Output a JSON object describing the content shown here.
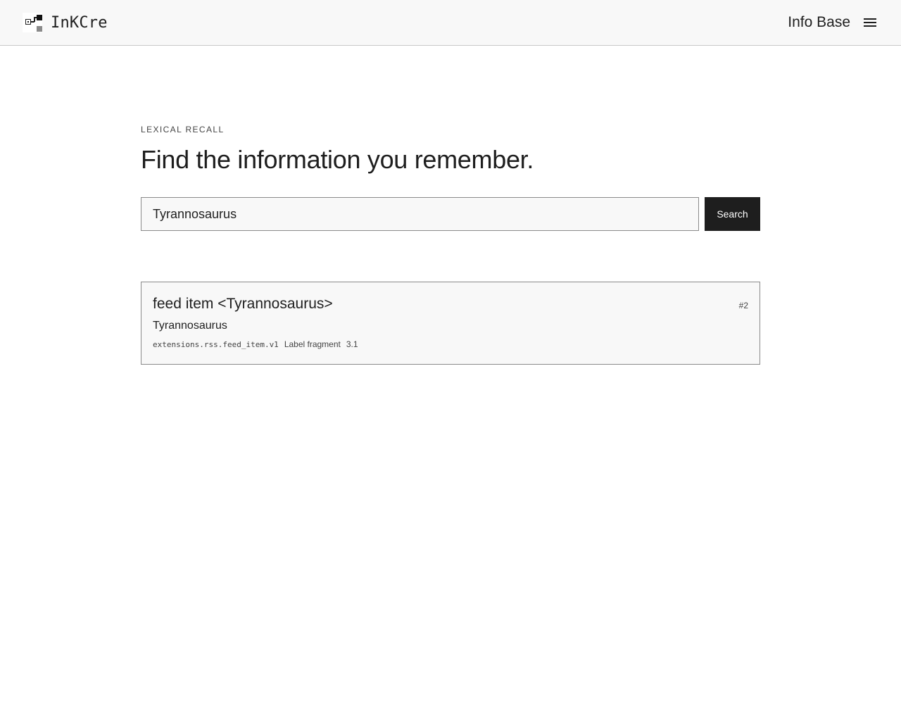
{
  "header": {
    "brand_name": "InKCre",
    "nav_link": "Info Base",
    "menu_icon": "hamburger-menu-icon",
    "logo_icon": "inkcre-logo-icon"
  },
  "main": {
    "eyebrow": "LEXICAL RECALL",
    "headline": "Find the information you remember.",
    "search": {
      "value": "Tyrannosaurus",
      "placeholder": "",
      "button_label": "Search"
    }
  },
  "results": [
    {
      "title": "feed item <Tyrannosaurus>",
      "rank": "#2",
      "snippet": "Tyrannosaurus",
      "type": "extensions.rss.feed_item.v1",
      "kind": "Label fragment",
      "score": "3.1"
    }
  ]
}
